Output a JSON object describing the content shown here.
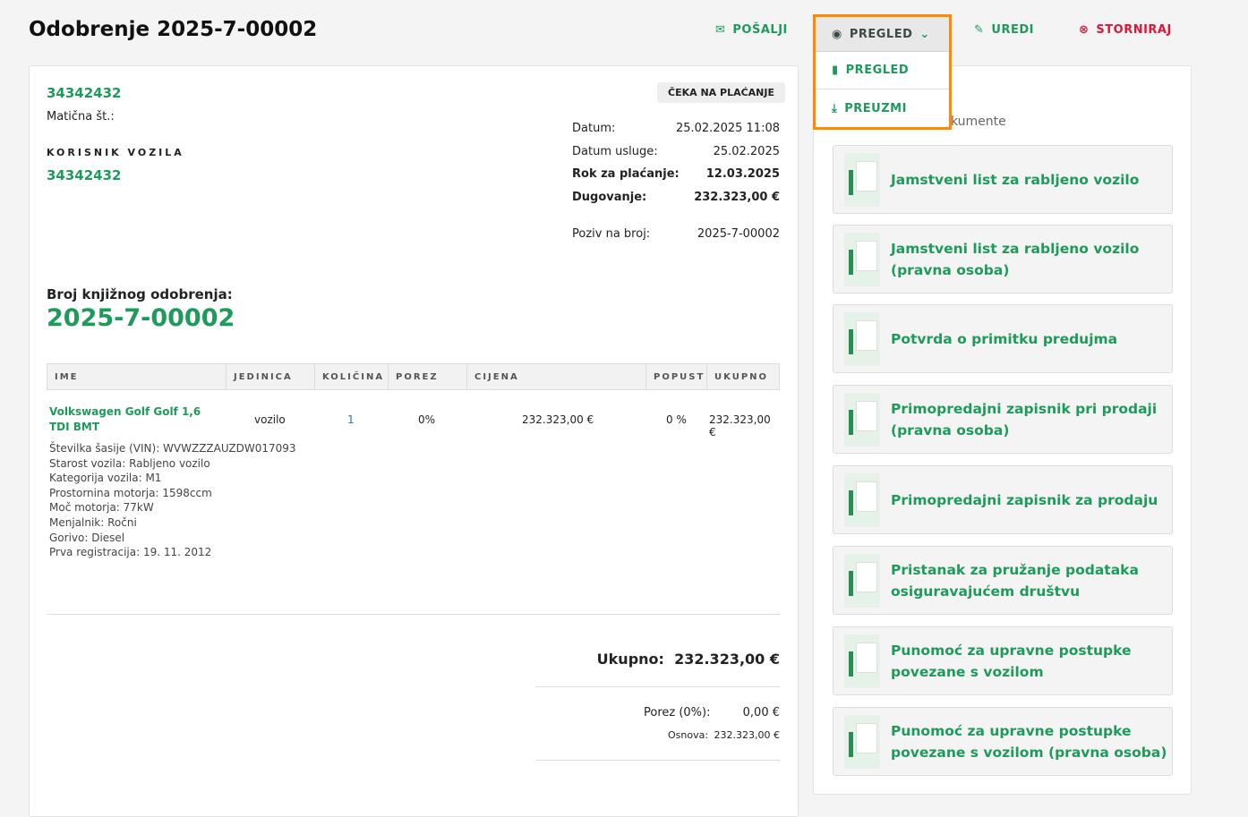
{
  "header": {
    "title": "Odobrenje 2025-7-00002",
    "send": "POŠALJI",
    "preview": "PREGLED",
    "edit": "UREDI",
    "cancel": "STORNIRAJ"
  },
  "dropdown": {
    "items": [
      "PREGLED",
      "PREUZMI"
    ]
  },
  "client": {
    "id": "34342432",
    "tax_label": "Matična št.:",
    "vehicle_user_label": "KORISNIK VOZILA",
    "vehicle_user": "34342432"
  },
  "status": "ČEKA NA PLAĆANJE",
  "meta": [
    {
      "label": "Datum:",
      "value": "25.02.2025 11:08",
      "bold": false
    },
    {
      "label": "Datum usluge:",
      "value": "25.02.2025",
      "bold": false
    },
    {
      "label": "Rok za plaćanje:",
      "value": "12.03.2025",
      "bold": true
    },
    {
      "label": "Dugovanje:",
      "value": "232.323,00 €",
      "bold": true
    },
    {
      "label": "Poziv na broj:",
      "value": "2025-7-00002",
      "bold": false
    }
  ],
  "doc_number": {
    "label": "Broj knjižnog odobrenja:",
    "value": "2025-7-00002"
  },
  "table": {
    "headers": [
      "IME",
      "JEDINICA",
      "KOLIČINA",
      "POREZ",
      "CIJENA",
      "POPUST",
      "UKUPNO"
    ],
    "row": {
      "name": "Volkswagen Golf Golf 1,6 TDI BMT",
      "unit": "vozilo",
      "qty": "1",
      "tax": "0%",
      "price": "232.323,00 €",
      "discount": "0 %",
      "total": "232.323,00 €",
      "specs": [
        "Številka šasije (VIN): WVWZZZAUZDW017093",
        "Starost vozila: Rabljeno vozilo",
        "Kategorija vozila: M1",
        "Prostornina motorja: 1598ccm",
        "Moč motorja: 77kW",
        "Menjalnik: Ročni",
        "Gorivo: Diesel",
        "Prva registracija: 19. 11. 2012"
      ]
    }
  },
  "totals": {
    "total_label": "Ukupno:",
    "total": "232.323,00 €",
    "tax_label": "Porez (0%):",
    "tax": "0,00 €",
    "base_label": "Osnova:",
    "base": "232.323,00 €"
  },
  "documents": {
    "heading": "kumente",
    "items": [
      "Jamstveni list za rabljeno vozilo",
      "Jamstveni list za rabljeno vozilo (pravna osoba)",
      "Potvrda o primitku predujma",
      "Primopredajni zapisnik pri prodaji (pravna osoba)",
      "Primopredajni zapisnik za prodaju",
      "Pristanak za pružanje podataka osiguravajućem društvu",
      "Punomoć za upravne postupke povezane s vozilom",
      "Punomoć za upravne postupke povezane s vozilom (pravna osoba)"
    ]
  }
}
